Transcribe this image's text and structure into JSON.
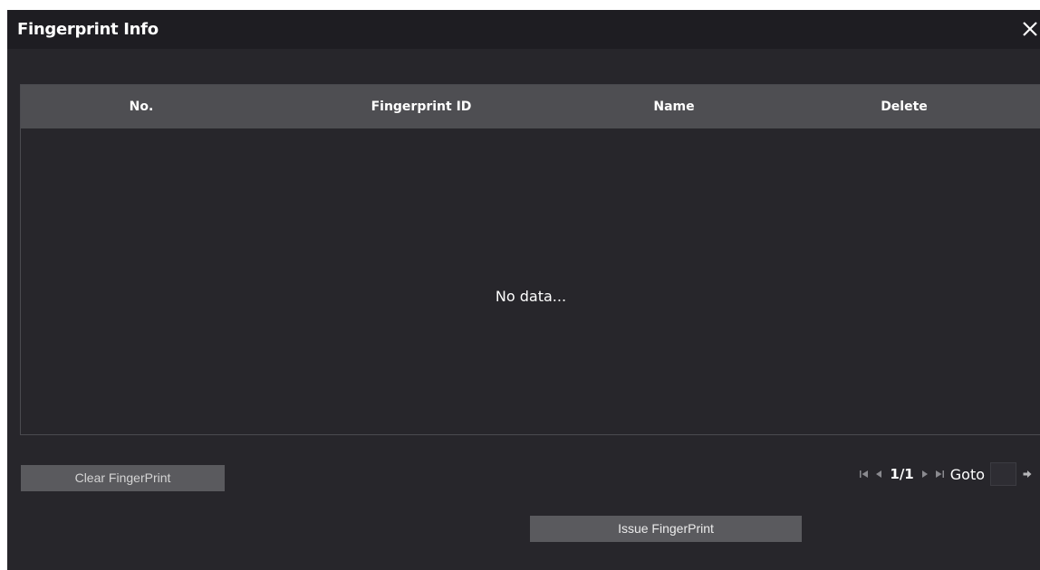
{
  "dialog": {
    "title": "Fingerprint Info"
  },
  "table": {
    "columns": [
      "No.",
      "Fingerprint ID",
      "Name",
      "Delete"
    ],
    "rows": [],
    "empty_text": "No data..."
  },
  "actions": {
    "clear_label": "Clear FingerPrint",
    "issue_label": "Issue FingerPrint"
  },
  "pagination": {
    "page_text": "1/1",
    "goto_label": "Goto",
    "goto_value": ""
  },
  "icons": {
    "close": "close-icon",
    "first": "first-page-icon",
    "prev": "prev-page-icon",
    "next": "next-page-icon",
    "last": "last-page-icon",
    "go": "go-arrow-icon"
  },
  "colors": {
    "dialog_bg": "#27262b",
    "titlebar_bg": "#1e1d22",
    "header_bg": "#4e4e52",
    "button_bg": "#5a5a5e"
  }
}
